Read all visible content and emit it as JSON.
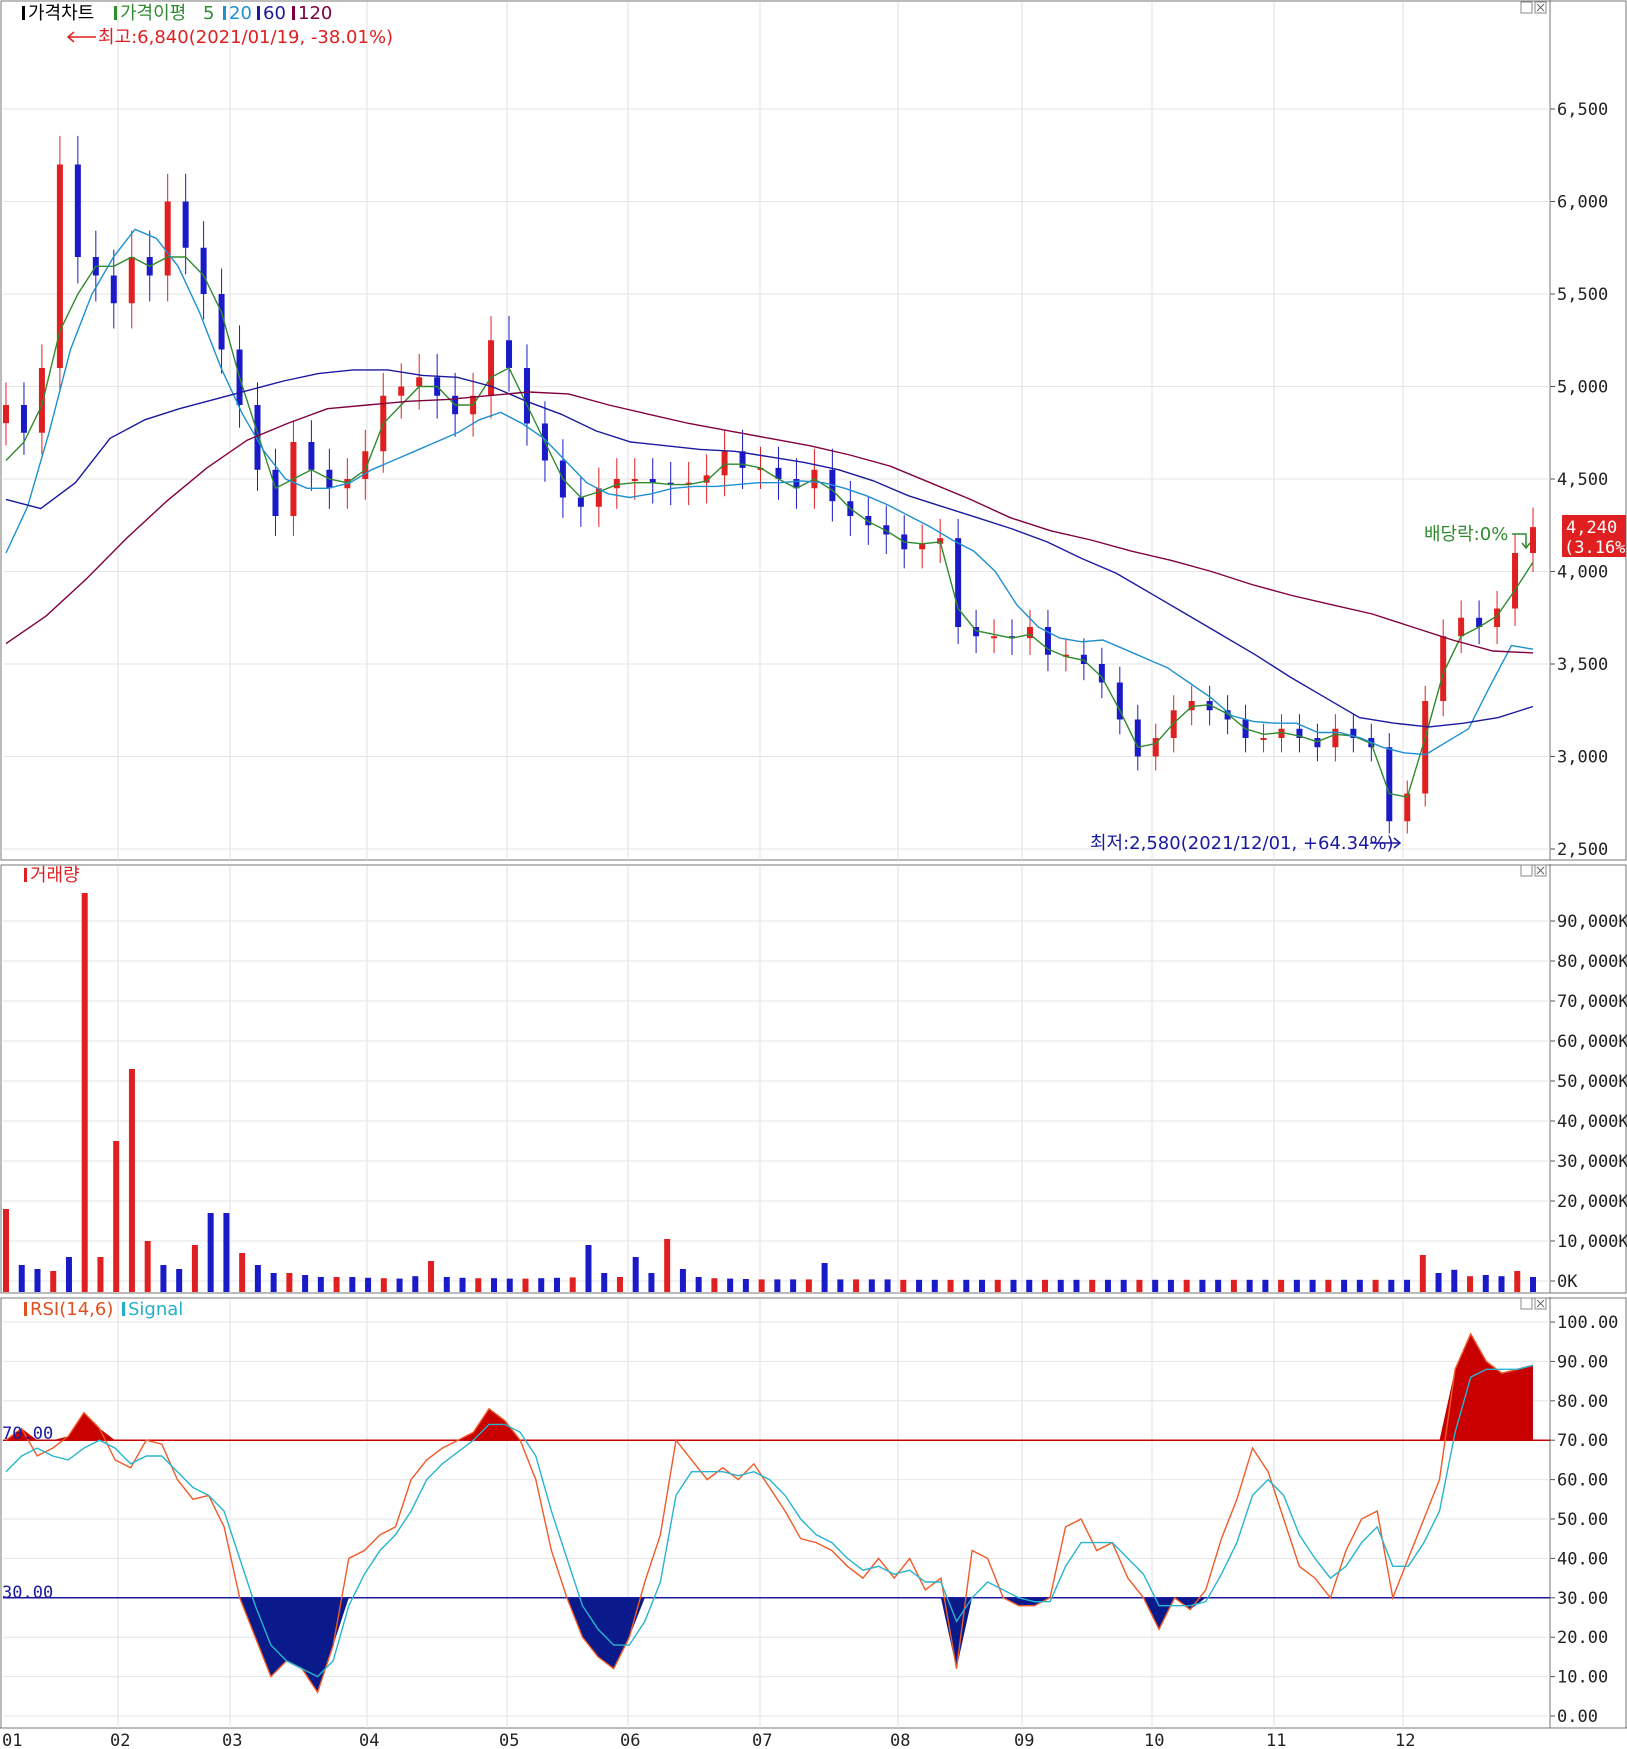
{
  "price_panel": {
    "legend": [
      {
        "label": "가격차트",
        "color": "#000000"
      },
      {
        "label": "가격이평",
        "color": "#2e8b2e"
      },
      {
        "label": "5",
        "color": "#2e8b2e"
      },
      {
        "label": "20",
        "color": "#1e90d0"
      },
      {
        "label": "60",
        "color": "#1a1aa0"
      },
      {
        "label": "120",
        "color": "#800040"
      }
    ],
    "high_annotation": "최고:6,840(2021/01/19, -38.01%)",
    "low_annotation": "최저:2,580(2021/12/01, +64.34%)",
    "dividend_annotation": "배당락:0%",
    "current_price": "4,240",
    "current_change": "(3.16%)"
  },
  "volume_panel": {
    "legend": "거래량"
  },
  "rsi_panel": {
    "legend": [
      {
        "label": "RSI(14,6)",
        "color": "#e05020"
      },
      {
        "label": "Signal",
        "color": "#20b0c8"
      }
    ],
    "overbought_label": "70.00",
    "oversold_label": "30.00"
  },
  "x_axis": {
    "months": [
      "01",
      "02",
      "03",
      "04",
      "05",
      "06",
      "07",
      "08",
      "09",
      "10",
      "11",
      "12"
    ]
  },
  "chart_data": [
    {
      "type": "candlestick",
      "title": "가격차트",
      "ylim": [
        2500,
        6700
      ],
      "y_ticks": [
        "6,500",
        "6,000",
        "5,500",
        "5,000",
        "4,500",
        "4,000",
        "3,500",
        "3,000",
        "2,500"
      ],
      "series": [
        {
          "name": "가격",
          "values": [
            4900,
            4750,
            5100,
            6200,
            5700,
            5600,
            5450,
            5700,
            5600,
            6000,
            5750,
            5500,
            5200,
            4900,
            4550,
            4300,
            4700,
            4550,
            4450,
            4500,
            4650,
            4950,
            5000,
            5050,
            4950,
            4850,
            4950,
            5250,
            5100,
            4800,
            4600,
            4400,
            4350,
            4450,
            4500,
            4500,
            4480,
            4470,
            4480,
            4520,
            4650,
            4560,
            4560,
            4500,
            4450,
            4550,
            4380,
            4300,
            4250,
            4200,
            4120,
            4150,
            4180,
            3700,
            3650,
            3650,
            3640,
            3700,
            3550,
            3550,
            3500,
            3400,
            3200,
            3000,
            3100,
            3250,
            3300,
            3250,
            3200,
            3100,
            3100,
            3150,
            3100,
            3050,
            3150,
            3100,
            3050,
            2650,
            2800,
            3300,
            3650,
            3750,
            3700,
            3800,
            4100,
            4240
          ]
        },
        {
          "name": "5",
          "values": [
            4600,
            4700,
            4900,
            5300,
            5500,
            5650,
            5650,
            5700,
            5650,
            5700,
            5700,
            5600,
            5400,
            5050,
            4750,
            4450,
            4500,
            4550,
            4500,
            4480,
            4550,
            4800,
            4900,
            5000,
            5000,
            4900,
            4900,
            5050,
            5100,
            4900,
            4700,
            4500,
            4400,
            4430,
            4470,
            4480,
            4480,
            4470,
            4470,
            4490,
            4580,
            4580,
            4560,
            4500,
            4450,
            4500,
            4440,
            4340,
            4270,
            4220,
            4160,
            4150,
            4160,
            3800,
            3680,
            3660,
            3640,
            3660,
            3580,
            3540,
            3520,
            3430,
            3250,
            3050,
            3070,
            3180,
            3270,
            3280,
            3230,
            3150,
            3120,
            3130,
            3110,
            3080,
            3120,
            3110,
            3070,
            2800,
            2780,
            3100,
            3450,
            3650,
            3700,
            3760,
            3900,
            4050
          ]
        },
        {
          "name": "20",
          "values": [
            4100,
            4350,
            4750,
            5200,
            5500,
            5700,
            5850,
            5800,
            5650,
            5400,
            5100,
            4850,
            4650,
            4500,
            4450,
            4450,
            4480,
            4550,
            4600,
            4650,
            4700,
            4750,
            4820,
            4860,
            4800,
            4720,
            4600,
            4480,
            4420,
            4400,
            4420,
            4450,
            4460,
            4460,
            4470,
            4480,
            4480,
            4490,
            4480,
            4450,
            4410,
            4360,
            4300,
            4240,
            4170,
            4110,
            4000,
            3820,
            3700,
            3640,
            3620,
            3630,
            3580,
            3530,
            3480,
            3400,
            3320,
            3220,
            3190,
            3180,
            3180,
            3130,
            3130,
            3100,
            3050,
            3020,
            3010,
            3080,
            3150,
            3380,
            3600,
            3580
          ]
        },
        {
          "name": "60",
          "values": [
            4390,
            4340,
            4480,
            4720,
            4820,
            4880,
            4930,
            4980,
            5030,
            5070,
            5090,
            5090,
            5060,
            5050,
            5000,
            4920,
            4850,
            4760,
            4700,
            4680,
            4660,
            4650,
            4620,
            4590,
            4550,
            4490,
            4410,
            4350,
            4290,
            4230,
            4160,
            4070,
            3990,
            3880,
            3770,
            3660,
            3550,
            3430,
            3320,
            3210,
            3180,
            3160,
            3180,
            3210,
            3270
          ]
        },
        {
          "name": "120",
          "values": [
            3610,
            3760,
            3960,
            4180,
            4380,
            4560,
            4710,
            4800,
            4880,
            4900,
            4920,
            4930,
            4950,
            4970,
            4960,
            4900,
            4850,
            4800,
            4760,
            4720,
            4680,
            4630,
            4570,
            4480,
            4390,
            4290,
            4220,
            4170,
            4110,
            4060,
            4000,
            3930,
            3870,
            3820,
            3770,
            3700,
            3630,
            3570,
            3560
          ]
        }
      ]
    },
    {
      "type": "bar",
      "title": "거래량",
      "ylim": [
        0,
        100000
      ],
      "y_ticks": [
        "90,000K",
        "80,000K",
        "70,000K",
        "60,000K",
        "50,000K",
        "40,000K",
        "30,000K",
        "20,000K",
        "10,000K",
        "0K"
      ],
      "series": [
        {
          "name": "거래량",
          "values": [
            18000,
            4000,
            3000,
            2500,
            6000,
            97000,
            6000,
            35000,
            53000,
            10000,
            4000,
            3000,
            9000,
            17000,
            17000,
            7000,
            4000,
            2000,
            2000,
            1500,
            1000,
            1000,
            1000,
            800,
            700,
            600,
            1200,
            5000,
            1000,
            800,
            700,
            700,
            600,
            600,
            700,
            800,
            900,
            9000,
            2000,
            1000,
            6000,
            2000,
            10500,
            3000,
            1000,
            700,
            600,
            500,
            400,
            400,
            400,
            400,
            4500,
            400,
            400,
            400,
            400,
            300,
            300,
            300,
            300,
            300,
            300,
            300,
            300,
            300,
            300,
            300,
            300,
            300,
            300,
            300,
            300,
            300,
            300,
            300,
            300,
            300,
            300,
            300,
            300,
            300,
            300,
            300,
            300,
            300,
            300,
            300,
            300,
            300,
            6500,
            2000,
            2800,
            1200,
            1500,
            1200,
            2500,
            1000
          ]
        }
      ]
    },
    {
      "type": "line",
      "title": "RSI(14,6)",
      "ylim": [
        0,
        100
      ],
      "y_ticks": [
        "100.00",
        "90.00",
        "80.00",
        "70.00",
        "60.00",
        "50.00",
        "40.00",
        "30.00",
        "20.00",
        "10.00",
        "0.00"
      ],
      "series": [
        {
          "name": "RSI(14,6)",
          "values": [
            70,
            73,
            66,
            68,
            71,
            77,
            73,
            65,
            63,
            70,
            69,
            60,
            55,
            56,
            48,
            30,
            20,
            10,
            14,
            12,
            6,
            18,
            40,
            42,
            46,
            48,
            60,
            65,
            68,
            70,
            72,
            78,
            75,
            70,
            60,
            42,
            30,
            20,
            15,
            12,
            20,
            34,
            46,
            70,
            65,
            60,
            63,
            60,
            64,
            58,
            52,
            45,
            44,
            42,
            38,
            35,
            40,
            35,
            40,
            32,
            35,
            12,
            42,
            40,
            30,
            28,
            28,
            30,
            48,
            50,
            42,
            44,
            35,
            30,
            22,
            30,
            27,
            32,
            45,
            55,
            68,
            62,
            50,
            38,
            35,
            30,
            42,
            50,
            52,
            30,
            40,
            50,
            60,
            88,
            97,
            90,
            87,
            88,
            89
          ]
        },
        {
          "name": "Signal",
          "values": [
            62,
            66,
            68,
            66,
            65,
            68,
            70,
            68,
            64,
            66,
            66,
            62,
            58,
            56,
            52,
            40,
            28,
            18,
            14,
            12,
            10,
            14,
            28,
            36,
            42,
            46,
            52,
            60,
            64,
            67,
            70,
            74,
            74,
            72,
            66,
            52,
            40,
            28,
            22,
            18,
            18,
            24,
            34,
            56,
            62,
            62,
            62,
            61,
            62,
            60,
            56,
            50,
            46,
            44,
            40,
            37,
            38,
            36,
            37,
            34,
            34,
            24,
            30,
            34,
            32,
            30,
            29,
            29,
            38,
            44,
            44,
            44,
            40,
            36,
            28,
            28,
            28,
            29,
            36,
            44,
            56,
            60,
            56,
            46,
            40,
            35,
            38,
            44,
            48,
            38,
            38,
            44,
            52,
            72,
            86,
            88,
            88,
            88,
            89
          ]
        }
      ]
    }
  ]
}
